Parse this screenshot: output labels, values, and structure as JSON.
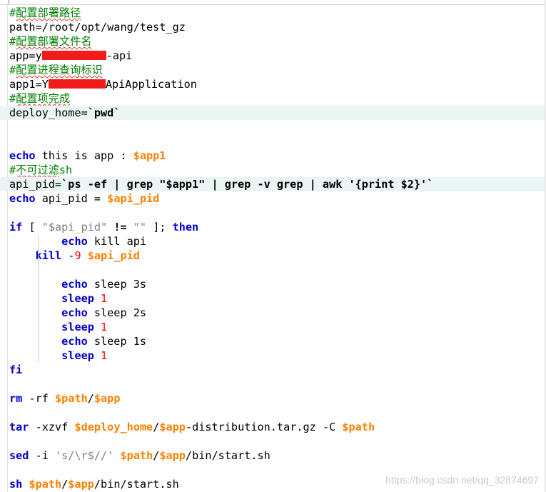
{
  "editor": {
    "language": "shell-script",
    "colors": {
      "comment": "#008000",
      "keyword": "#0000cc",
      "variable": "#ff8000",
      "number": "#ff0000",
      "string": "#808080",
      "redaction": "#f11b1b",
      "active_line": "#eaf6f4"
    }
  },
  "lines": [
    {
      "tokens": [
        {
          "t": "#",
          "c": "comment"
        },
        {
          "t": "配置部署路径",
          "c": "comment squiggle"
        }
      ]
    },
    {
      "tokens": [
        {
          "t": "path=/root/opt/wang/test_gz",
          "c": "plain"
        }
      ]
    },
    {
      "tokens": [
        {
          "t": "#",
          "c": "comment"
        },
        {
          "t": "配置部署文件名",
          "c": "comment squiggle"
        }
      ]
    },
    {
      "tokens": [
        {
          "t": "app=y",
          "c": "plain"
        },
        {
          "redact": 90
        },
        {
          "t": "-api",
          "c": "plain"
        }
      ]
    },
    {
      "tokens": [
        {
          "t": "#",
          "c": "comment"
        },
        {
          "t": "配置进程查询标识",
          "c": "comment squiggle"
        }
      ]
    },
    {
      "tokens": [
        {
          "t": "app1=Y",
          "c": "plain"
        },
        {
          "redact": 80
        },
        {
          "t": "ApiApplication",
          "c": "plain"
        }
      ]
    },
    {
      "tokens": [
        {
          "t": "#",
          "c": "comment"
        },
        {
          "t": "配置项完成",
          "c": "comment squiggle"
        }
      ]
    },
    {
      "tokens": [
        {
          "t": "deploy_home=",
          "c": "plain"
        },
        {
          "t": "`pwd`",
          "c": "operator"
        }
      ],
      "active": true
    },
    {
      "tokens": []
    },
    {
      "tokens": []
    },
    {
      "tokens": [
        {
          "t": "echo",
          "c": "keyword"
        },
        {
          "t": " this is app : ",
          "c": "plain"
        },
        {
          "t": "$app1",
          "c": "variable"
        }
      ]
    },
    {
      "tokens": [
        {
          "t": "#",
          "c": "comment"
        },
        {
          "t": "不可过滤",
          "c": "comment squiggle"
        },
        {
          "t": "sh",
          "c": "comment"
        }
      ]
    },
    {
      "tokens": [
        {
          "t": "api_pid=",
          "c": "plain"
        },
        {
          "t": "`ps -ef | grep \"$app1\" | grep -v grep | awk '{print $2}'`",
          "c": "operator"
        }
      ],
      "active": true
    },
    {
      "tokens": [
        {
          "t": "echo",
          "c": "keyword"
        },
        {
          "t": " api_pid = ",
          "c": "plain"
        },
        {
          "t": "$api_pid",
          "c": "variable"
        }
      ]
    },
    {
      "tokens": []
    },
    {
      "tokens": [
        {
          "t": "if",
          "c": "keyword"
        },
        {
          "t": " [ ",
          "c": "plain"
        },
        {
          "t": "\"$api_pid\"",
          "c": "string"
        },
        {
          "t": " != ",
          "c": "operator"
        },
        {
          "t": "\"\"",
          "c": "string"
        },
        {
          "t": " ]; ",
          "c": "plain"
        },
        {
          "t": "then",
          "c": "keyword"
        }
      ]
    },
    {
      "tokens": [
        {
          "t": "        ",
          "c": "plain"
        },
        {
          "t": "echo",
          "c": "keyword"
        },
        {
          "t": " kill api",
          "c": "plain"
        }
      ],
      "guide": true
    },
    {
      "tokens": [
        {
          "t": "    ",
          "c": "plain"
        },
        {
          "t": "kill",
          "c": "keyword"
        },
        {
          "t": " -",
          "c": "plain"
        },
        {
          "t": "9",
          "c": "number"
        },
        {
          "t": " ",
          "c": "plain"
        },
        {
          "t": "$api_pid",
          "c": "variable"
        }
      ],
      "guide": true
    },
    {
      "tokens": [],
      "guide": true
    },
    {
      "tokens": [
        {
          "t": "        ",
          "c": "plain"
        },
        {
          "t": "echo",
          "c": "keyword"
        },
        {
          "t": " sleep ",
          "c": "plain"
        },
        {
          "t": "3s",
          "c": "plain"
        }
      ],
      "guide": true
    },
    {
      "tokens": [
        {
          "t": "        ",
          "c": "plain"
        },
        {
          "t": "sleep",
          "c": "keyword"
        },
        {
          "t": " ",
          "c": "plain"
        },
        {
          "t": "1",
          "c": "number"
        }
      ],
      "guide": true
    },
    {
      "tokens": [
        {
          "t": "        ",
          "c": "plain"
        },
        {
          "t": "echo",
          "c": "keyword"
        },
        {
          "t": " sleep ",
          "c": "plain"
        },
        {
          "t": "2s",
          "c": "plain"
        }
      ],
      "guide": true
    },
    {
      "tokens": [
        {
          "t": "        ",
          "c": "plain"
        },
        {
          "t": "sleep",
          "c": "keyword"
        },
        {
          "t": " ",
          "c": "plain"
        },
        {
          "t": "1",
          "c": "number"
        }
      ],
      "guide": true
    },
    {
      "tokens": [
        {
          "t": "        ",
          "c": "plain"
        },
        {
          "t": "echo",
          "c": "keyword"
        },
        {
          "t": " sleep ",
          "c": "plain"
        },
        {
          "t": "1s",
          "c": "plain"
        }
      ],
      "guide": true
    },
    {
      "tokens": [
        {
          "t": "        ",
          "c": "plain"
        },
        {
          "t": "sleep",
          "c": "keyword"
        },
        {
          "t": " ",
          "c": "plain"
        },
        {
          "t": "1",
          "c": "number"
        }
      ],
      "guide": true
    },
    {
      "tokens": [
        {
          "t": "fi",
          "c": "keyword"
        }
      ]
    },
    {
      "tokens": []
    },
    {
      "tokens": [
        {
          "t": "rm",
          "c": "keyword"
        },
        {
          "t": " -rf ",
          "c": "plain"
        },
        {
          "t": "$path",
          "c": "variable"
        },
        {
          "t": "/",
          "c": "plain"
        },
        {
          "t": "$app",
          "c": "variable"
        }
      ]
    },
    {
      "tokens": []
    },
    {
      "tokens": [
        {
          "t": "tar",
          "c": "keyword"
        },
        {
          "t": " -xzvf ",
          "c": "plain"
        },
        {
          "t": "$deploy_home",
          "c": "variable"
        },
        {
          "t": "/",
          "c": "plain"
        },
        {
          "t": "$app",
          "c": "variable"
        },
        {
          "t": "-distribution.tar.gz -C ",
          "c": "plain"
        },
        {
          "t": "$path",
          "c": "variable"
        }
      ]
    },
    {
      "tokens": []
    },
    {
      "tokens": [
        {
          "t": "sed",
          "c": "keyword"
        },
        {
          "t": " -i ",
          "c": "plain"
        },
        {
          "t": "'s/\\r$//'",
          "c": "string"
        },
        {
          "t": " ",
          "c": "plain"
        },
        {
          "t": "$path",
          "c": "variable"
        },
        {
          "t": "/",
          "c": "plain"
        },
        {
          "t": "$app",
          "c": "variable"
        },
        {
          "t": "/bin/start.sh",
          "c": "plain"
        }
      ]
    },
    {
      "tokens": []
    },
    {
      "tokens": [
        {
          "t": "sh",
          "c": "keyword"
        },
        {
          "t": " ",
          "c": "plain"
        },
        {
          "t": "$path",
          "c": "variable"
        },
        {
          "t": "/",
          "c": "plain"
        },
        {
          "t": "$app",
          "c": "variable"
        },
        {
          "t": "/bin/start.sh",
          "c": "plain"
        }
      ]
    }
  ],
  "watermark": "https://blog.csdn.net/qq_32874697"
}
